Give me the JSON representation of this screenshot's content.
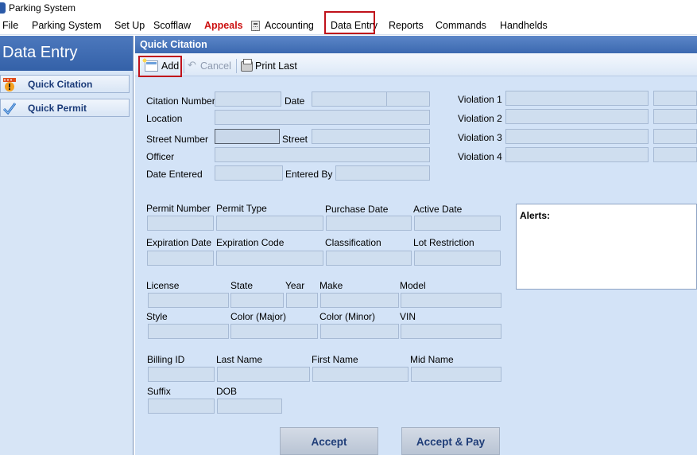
{
  "app": {
    "title": "Parking System"
  },
  "menu": {
    "file": "File",
    "parking_system": "Parking System",
    "set_up": "Set Up",
    "scofflaw": "Scofflaw",
    "appeals": "Appeals",
    "accounting": "Accounting",
    "data_entry": "Data Entry",
    "reports": "Reports",
    "commands": "Commands",
    "handhelds": "Handhelds"
  },
  "nav": {
    "title": "Data Entry",
    "items": [
      {
        "label": "Quick Citation",
        "icon": "citation-icon"
      },
      {
        "label": "Quick Permit",
        "icon": "checkmark-icon"
      }
    ]
  },
  "panel": {
    "title": "Quick Citation"
  },
  "toolbar": {
    "add": "Add",
    "cancel": "Cancel",
    "print_last": "Print Last"
  },
  "citation": {
    "citation_number": "Citation Number",
    "date": "Date",
    "location": "Location",
    "street_number": "Street Number",
    "street": "Street",
    "officer": "Officer",
    "date_entered": "Date Entered",
    "entered_by": "Entered By",
    "violations": [
      "Violation 1",
      "Violation 2",
      "Violation 3",
      "Violation 4"
    ]
  },
  "permit": {
    "permit_number": "Permit Number",
    "permit_type": "Permit Type",
    "purchase_date": "Purchase Date",
    "active_date": "Active Date",
    "expiration_date": "Expiration Date",
    "expiration_code": "Expiration Code",
    "classification": "Classification",
    "lot_restriction": "Lot Restriction"
  },
  "alerts": {
    "label": "Alerts:"
  },
  "vehicle": {
    "license": "License",
    "state": "State",
    "year": "Year",
    "make": "Make",
    "model": "Model",
    "style": "Style",
    "color_major": "Color (Major)",
    "color_minor": "Color (Minor)",
    "vin": "VIN"
  },
  "billing": {
    "billing_id": "Billing ID",
    "last_name": "Last Name",
    "first_name": "First Name",
    "mid_name": "Mid Name",
    "suffix": "Suffix",
    "dob": "DOB"
  },
  "actions": {
    "accept": "Accept",
    "accept_pay": "Accept & Pay"
  },
  "colors": {
    "header_blue": "#3c69b0",
    "panel_bg": "#d3e3f7",
    "highlight_red": "#c0121b",
    "appeals_red": "#cc1111"
  }
}
